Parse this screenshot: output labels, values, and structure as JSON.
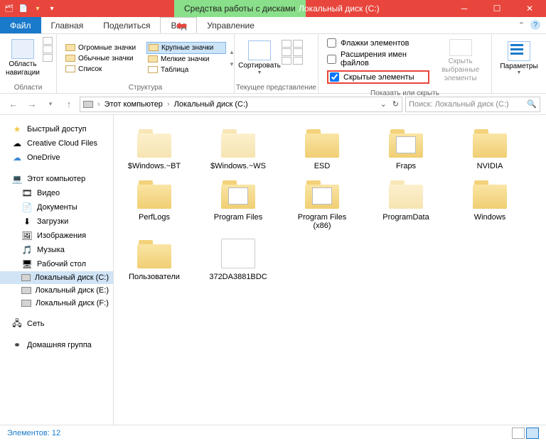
{
  "titlebar": {
    "context_tab": "Средства работы с дисками",
    "title": "Локальный диск (C:)"
  },
  "tabs": {
    "file": "Файл",
    "home": "Главная",
    "share": "Поделиться",
    "view": "Вид",
    "manage": "Управление"
  },
  "ribbon": {
    "panes_btn": "Область навигации",
    "panes_label": "Области",
    "layout": {
      "huge": "Огромные значки",
      "large": "Крупные значки",
      "medium": "Обычные значки",
      "small": "Мелкие значки",
      "list": "Список",
      "table": "Таблица",
      "label": "Структура"
    },
    "sort_btn": "Сортировать",
    "view_label": "Текущее представление",
    "checks": {
      "item_check": "Флажки элементов",
      "ext": "Расширения имен файлов",
      "hidden": "Скрытые элементы"
    },
    "hide_sel": "Скрыть выбранные элементы",
    "show_hide_label": "Показать или скрыть",
    "params": "Параметры"
  },
  "address": {
    "this_pc": "Этот компьютер",
    "drive": "Локальный диск (C:)"
  },
  "search_placeholder": "Поиск: Локальный диск (C:)",
  "nav": {
    "quick": "Быстрый доступ",
    "ccloud": "Creative Cloud Files",
    "onedrive": "OneDrive",
    "thispc": "Этот компьютер",
    "videos": "Видео",
    "documents": "Документы",
    "downloads": "Загрузки",
    "pictures": "Изображения",
    "music": "Музыка",
    "desktop": "Рабочий стол",
    "drive_c": "Локальный диск (C:)",
    "drive_e": "Локальный диск (E:)",
    "drive_f": "Локальный диск (F:)",
    "network": "Сеть",
    "homegroup": "Домашняя группа"
  },
  "items": [
    {
      "name": "$Windows.~BT",
      "hidden": true,
      "type": "folder"
    },
    {
      "name": "$Windows.~WS",
      "hidden": true,
      "type": "folder"
    },
    {
      "name": "ESD",
      "hidden": false,
      "type": "folder"
    },
    {
      "name": "Fraps",
      "hidden": false,
      "type": "folder-app"
    },
    {
      "name": "NVIDIA",
      "hidden": false,
      "type": "folder"
    },
    {
      "name": "PerfLogs",
      "hidden": false,
      "type": "folder"
    },
    {
      "name": "Program Files",
      "hidden": false,
      "type": "folder-docs"
    },
    {
      "name": "Program Files (x86)",
      "hidden": false,
      "type": "folder-docs"
    },
    {
      "name": "ProgramData",
      "hidden": true,
      "type": "folder"
    },
    {
      "name": "Windows",
      "hidden": false,
      "type": "folder"
    },
    {
      "name": "Пользователи",
      "hidden": false,
      "type": "folder"
    },
    {
      "name": "372DA3881BDC",
      "hidden": false,
      "type": "file"
    }
  ],
  "status": "Элементов: 12"
}
